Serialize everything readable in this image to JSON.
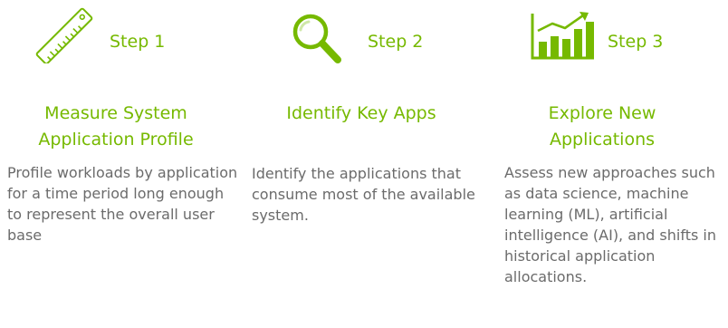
{
  "accent_color": "#76b900",
  "text_color": "#6b6b6b",
  "steps": [
    {
      "icon": "ruler-icon",
      "label": "Step 1",
      "heading": "Measure System Application Profile",
      "description": "Profile workloads by application for a time period long enough to represent the overall user base"
    },
    {
      "icon": "magnifier-icon",
      "label": "Step 2",
      "heading": "Identify Key Apps",
      "description": "Identify the applications that consume most of the available system."
    },
    {
      "icon": "bar-chart-growth-icon",
      "label": "Step 3",
      "heading": "Explore New Applications",
      "description": "Assess new approaches such as data science, machine learning (ML), artificial intelligence (AI), and shifts in historical application allocations."
    }
  ]
}
